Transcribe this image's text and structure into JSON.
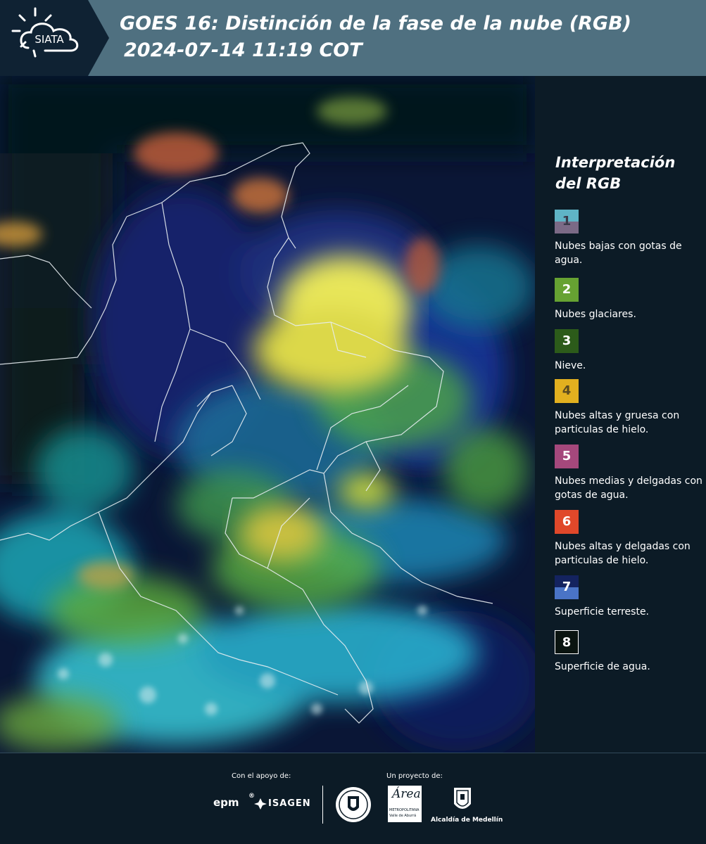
{
  "header": {
    "logo_text": "SIATA",
    "title_line1": "GOES 16: Distinción de la fase de la nube (RGB)",
    "title_line2": "2024-07-14 11:19 COT"
  },
  "legend": {
    "title_line1": "Interpretación",
    "title_line2": "del RGB",
    "items": [
      {
        "num": "1",
        "label": "Nubes bajas con gotas de agua.",
        "color_top": "#5fb4c6",
        "color_bottom": "#7b6a86"
      },
      {
        "num": "2",
        "label": "Nubes glaciares.",
        "color_top": "#66a232",
        "color_bottom": "#66a232"
      },
      {
        "num": "3",
        "label": "Nieve.",
        "color_top": "#2c5b1a",
        "color_bottom": "#2c5b1a"
      },
      {
        "num": "4",
        "label": "Nubes altas y gruesa con particulas de hielo.",
        "color_top": "#e2b01f",
        "color_bottom": "#e2b01f"
      },
      {
        "num": "5",
        "label": "Nubes medias y delgadas con gotas de agua.",
        "color_top": "#a5487c",
        "color_bottom": "#a5487c"
      },
      {
        "num": "6",
        "label": "Nubes altas y delgadas con particulas de hielo.",
        "color_top": "#e0482a",
        "color_bottom": "#e0482a"
      },
      {
        "num": "7",
        "label": "Superficie terreste.",
        "color_top": "#14235f",
        "color_bottom": "#4a74c6"
      },
      {
        "num": "8",
        "label": "Superficie de agua.",
        "color_top": "#0a1410",
        "color_bottom": "#0a1410"
      }
    ]
  },
  "footer": {
    "support_label": "Con el apoyo de:",
    "project_label": "Un proyecto de:",
    "epm": "epm",
    "isagen": "ISAGEN",
    "area_line1": "Área",
    "area_line2": "METROPOLITANA",
    "area_line3": "Valle de Aburrá",
    "alcaldia": "Alcaldía de Medellín"
  }
}
